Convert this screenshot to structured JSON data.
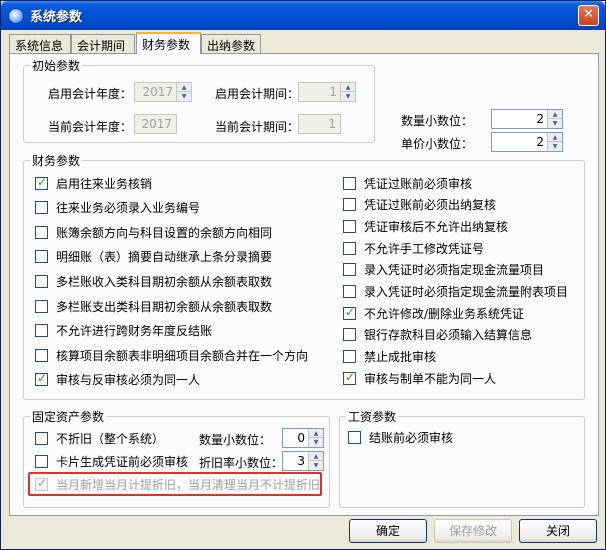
{
  "window": {
    "title": "系统参数",
    "close_symbol": "✕"
  },
  "tabs": [
    {
      "label": "系统信息",
      "active": false
    },
    {
      "label": "会计期间",
      "active": false
    },
    {
      "label": "财务参数",
      "active": true
    },
    {
      "label": "出纳参数",
      "active": false
    }
  ],
  "initial": {
    "legend": "初始参数",
    "start_year_label": "启用会计年度：",
    "start_year_value": "2017",
    "start_period_label": "启用会计期间：",
    "start_period_value": "1",
    "current_year_label": "当前会计年度：",
    "current_year_value": "2017",
    "current_period_label": "当前会计期间：",
    "current_period_value": "1",
    "qty_decimals_label": "数量小数位：",
    "qty_decimals_value": "2",
    "price_decimals_label": "单价小数位：",
    "price_decimals_value": "2"
  },
  "finance": {
    "legend": "财务参数",
    "left": [
      {
        "label": "启用往来业务核销",
        "checked": true
      },
      {
        "label": "往来业务必须录入业务编号",
        "checked": false
      },
      {
        "label": "账簿余额方向与科目设置的余额方向相同",
        "checked": false
      },
      {
        "label": "明细账（表）摘要自动继承上条分录摘要",
        "checked": false
      },
      {
        "label": "多栏账收入类科目期初余额从余额表取数",
        "checked": false
      },
      {
        "label": "多栏账支出类科目期初余额从余额表取数",
        "checked": false
      },
      {
        "label": "不允许进行跨财务年度反结账",
        "checked": false
      },
      {
        "label": "核算项目余额表非明细项目余额合并在一个方向",
        "checked": false
      },
      {
        "label": "审核与反审核必须为同一人",
        "checked": true
      }
    ],
    "right": [
      {
        "label": "凭证过账前必须审核",
        "checked": false
      },
      {
        "label": "凭证过账前必须出纳复核",
        "checked": false
      },
      {
        "label": "凭证审核后不允许出纳复核",
        "checked": false
      },
      {
        "label": "不允许手工修改凭证号",
        "checked": false
      },
      {
        "label": "录入凭证时必须指定现金流量项目",
        "checked": false
      },
      {
        "label": "录入凭证时必须指定现金流量附表项目",
        "checked": false
      },
      {
        "label": "不允许修改/删除业务系统凭证",
        "checked": true
      },
      {
        "label": "银行存款科目必须输入结算信息",
        "checked": false
      },
      {
        "label": "禁止成批审核",
        "checked": false
      },
      {
        "label": "审核与制单不能为同一人",
        "checked": true
      }
    ]
  },
  "fixed_assets": {
    "legend": "固定资产参数",
    "no_depreciation_label": "不折旧（整个系统）",
    "card_audit_label": "卡片生成凭证前必须审核",
    "qty_decimals_label": "数量小数位：",
    "qty_decimals_value": "0",
    "rate_decimals_label": "折旧率小数位：",
    "rate_decimals_value": "3",
    "monthly_rule_label": "当月新增当月计提折旧，当月清理当月不计提折旧"
  },
  "salary": {
    "legend": "工资参数",
    "audit_label": "结账前必须审核"
  },
  "buttons": {
    "ok": "确定",
    "save": "保存修改",
    "close": "关闭"
  },
  "colors": {
    "title_bar": "#0453d6",
    "highlight_border": "#e0302a",
    "check_mark": "#21a121"
  }
}
